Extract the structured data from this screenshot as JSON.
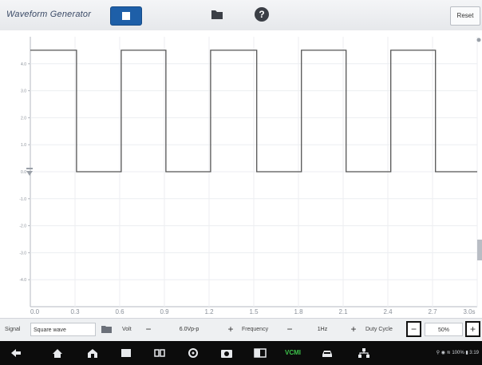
{
  "app": {
    "title": "Waveform Generator",
    "reset_label": "Reset"
  },
  "icons": {
    "stop": "stop-square-icon",
    "folder": "folder-icon",
    "help": "help-icon",
    "dropdown": "folder-dropdown-icon"
  },
  "chart_data": {
    "type": "line",
    "x_ticks": [
      "0.0",
      "0.3",
      "0.6",
      "0.9",
      "1.2",
      "1.5",
      "1.8",
      "2.1",
      "2.4",
      "2.7",
      "3.0s"
    ],
    "y_ticks": [
      "4.0",
      "3.0",
      "2.0",
      "1.0",
      "0.0",
      "-1.0",
      "-2.0",
      "-3.0",
      "-4.0"
    ],
    "xlim": [
      0,
      3.0
    ],
    "ylim": [
      -5.0,
      5.0
    ],
    "grid": true,
    "series": [
      {
        "color": "#555555",
        "points": [
          [
            0.0,
            4.5
          ],
          [
            0.31,
            4.5
          ],
          [
            0.31,
            0.0
          ],
          [
            0.61,
            0.0
          ],
          [
            0.61,
            4.5
          ],
          [
            0.91,
            4.5
          ],
          [
            0.91,
            0.0
          ],
          [
            1.21,
            0.0
          ],
          [
            1.21,
            4.5
          ],
          [
            1.52,
            4.5
          ],
          [
            1.52,
            0.0
          ],
          [
            1.82,
            0.0
          ],
          [
            1.82,
            4.5
          ],
          [
            2.12,
            4.5
          ],
          [
            2.12,
            0.0
          ],
          [
            2.42,
            0.0
          ],
          [
            2.42,
            4.5
          ],
          [
            2.72,
            4.5
          ],
          [
            2.72,
            0.0
          ],
          [
            3.0,
            0.0
          ]
        ]
      }
    ]
  },
  "toolbar": {
    "signal_label": "Signal",
    "signal_value": "Square wave",
    "volt_label": "Volt",
    "volt_minus": "−",
    "volt_value": "6.0Vp-p",
    "volt_plus": "+",
    "freq_label": "Frequency",
    "freq_minus": "−",
    "freq_value": "1Hz",
    "freq_plus": "+",
    "duty_label": "Duty Cycle",
    "duty_minus": "−",
    "duty_value": "50%",
    "duty_plus": "+"
  },
  "navbar": {
    "icons": [
      "back-icon",
      "home-icon",
      "house-icon",
      "window-icon",
      "multitask-icon",
      "settings-icon",
      "camera-icon",
      "split-screen-icon",
      "vcm-icon",
      "car-icon",
      "network-icon"
    ],
    "vcm_label": "VCMI",
    "status_text": "⚲ ◉ ≋ 100% ▮ 3:19"
  }
}
